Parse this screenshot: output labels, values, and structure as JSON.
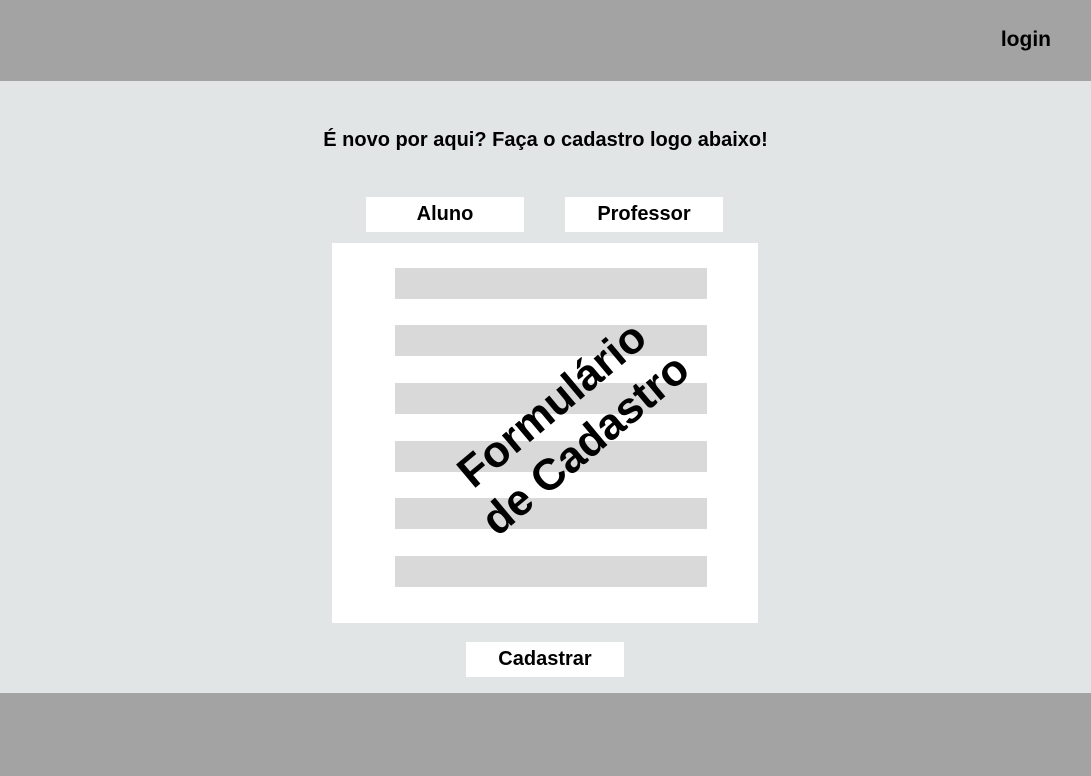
{
  "header": {
    "login_label": "login"
  },
  "main": {
    "heading": "É novo por aqui? Faça o cadastro logo abaixo!",
    "tabs": [
      {
        "label": "Aluno"
      },
      {
        "label": "Professor"
      }
    ],
    "form": {
      "watermark_line1": "Formulário",
      "watermark_line2": "de Cadastro",
      "field_count": 6
    },
    "submit_label": "Cadastrar"
  },
  "colors": {
    "header_footer_bg": "#a3a3a3",
    "page_bg": "#e2e5e6",
    "card_bg": "#ffffff",
    "field_bg": "#d9d9d9",
    "text": "#000000"
  }
}
